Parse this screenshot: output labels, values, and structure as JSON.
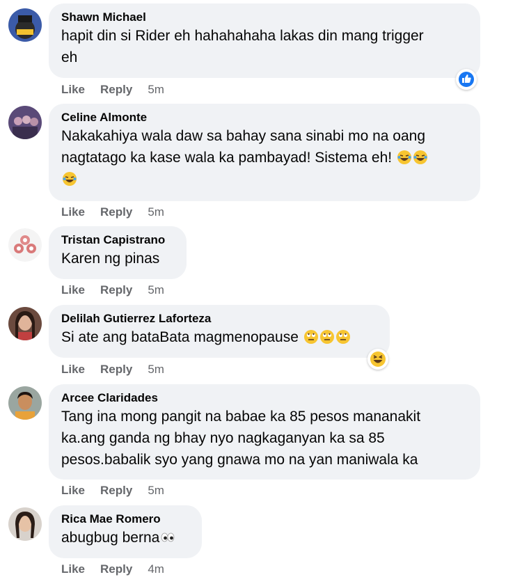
{
  "comments": [
    {
      "author": "Shawn Michael",
      "lines": [
        "hapit din si Rider eh hahahahaha lakas din mang trigger",
        "eh"
      ],
      "like": "Like",
      "reply": "Reply",
      "time": "5m",
      "reaction_icon": "like-reaction-icon"
    },
    {
      "author": "Celine Almonte",
      "lines": [
        "Nakakahiya wala daw sa bahay sana sinabi mo na oang",
        "nagtatago ka kase wala ka pambayad! Sistema eh!",
        ""
      ],
      "like": "Like",
      "reply": "Reply",
      "time": "5m",
      "emoji_icon": "laughing-tears-emoji"
    },
    {
      "author": "Tristan Capistrano",
      "lines": [
        "Karen ng pinas"
      ],
      "like": "Like",
      "reply": "Reply",
      "time": "5m"
    },
    {
      "author": "Delilah Gutierrez Laforteza",
      "lines": [
        "Si ate ang bataBata magmenopause"
      ],
      "like": "Like",
      "reply": "Reply",
      "time": "5m",
      "emoji_icon": "rolling-eyes-emoji",
      "reaction_icon": "haha-reaction-icon"
    },
    {
      "author": "Arcee Claridades",
      "lines": [
        "Tang ina mong pangit na babae ka 85 pesos mananakit",
        "ka.ang ganda ng bhay nyo nagkaganyan ka sa 85",
        "pesos.babalik syo yang gnawa mo na yan maniwala ka"
      ],
      "like": "Like",
      "reply": "Reply",
      "time": "5m"
    },
    {
      "author": "Rica Mae Romero",
      "lines": [
        "abugbug berna"
      ],
      "like": "Like",
      "reply": "Reply",
      "time": "4m",
      "emoji_icon": "eyes-emoji"
    }
  ],
  "colors": {
    "bubble": "#f0f2f5",
    "meta": "#65676b",
    "like_blue": "#1877f2",
    "emoji_yellow": "#f7c531"
  }
}
